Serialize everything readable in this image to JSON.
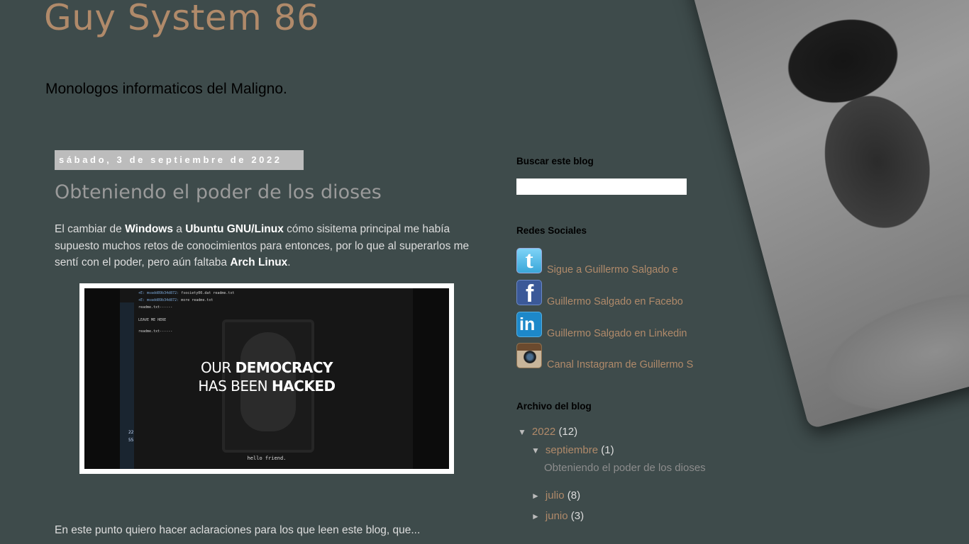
{
  "header": {
    "title": "Guy System 86",
    "description": "Monologos informaticos del Maligno."
  },
  "post": {
    "date": "sábado, 3 de septiembre de 2022",
    "title": "Obteniendo el poder de los dioses",
    "body": {
      "p1_a": "El cambiar de ",
      "p1_b": "Windows",
      "p1_c": " a ",
      "p1_d": "Ubuntu GNU/Linux",
      "p1_e": " cómo sisitema principal me había supuesto muchos retos de conocimientos para entonces, por lo que al superarlos me sentí con el poder, pero aún faltaba ",
      "p1_f": "Arch Linux",
      "p1_g": "."
    },
    "image": {
      "term_line_1_hl": "+E: mvadd89b34d872:",
      "term_line_1": " fsociety00.dat  readme.txt",
      "term_line_2_hl": "+E: mvadd89b34d872:",
      "term_line_2": " more readme.txt",
      "term_line_3": "readme.txt------",
      "term_line_4": "LEAVE ME HERE",
      "term_line_5": "readme.txt------",
      "headline_1_a": "OUR ",
      "headline_1_b": "DEMOCRACY",
      "headline_2_a": "HAS BEEN ",
      "headline_2_b": "HACKED",
      "footer": "hello friend.",
      "side_num_1": "22",
      "side_num_2": "55"
    },
    "excerpt": "En este punto quiero hacer aclaraciones para los que leen este blog, que..."
  },
  "sidebar": {
    "search": {
      "title": "Buscar este blog",
      "value": ""
    },
    "social": {
      "title": "Redes Sociales",
      "items": [
        {
          "icon": "twitter-icon",
          "label": "Sigue a Guillermo Salgado e"
        },
        {
          "icon": "facebook-icon",
          "label": "Guillermo Salgado en Facebo"
        },
        {
          "icon": "linkedin-icon",
          "label": "Guillermo Salgado en Linkedin"
        },
        {
          "icon": "instagram-icon",
          "label": "Canal Instagram de Guillermo S"
        }
      ]
    },
    "archive": {
      "title": "Archivo del blog",
      "year": {
        "label": "2022",
        "count": "(12)"
      },
      "months": [
        {
          "label": "septiembre",
          "count": "(1)",
          "expanded": true
        },
        {
          "label": "julio",
          "count": "(8)",
          "expanded": false
        },
        {
          "label": "junio",
          "count": "(3)",
          "expanded": false
        }
      ],
      "post_link": "Obteniendo el poder de los dioses"
    }
  },
  "colors": {
    "background": "#3e4b4b",
    "link": "#b08a6a",
    "date_header": "#bcbcbc"
  }
}
